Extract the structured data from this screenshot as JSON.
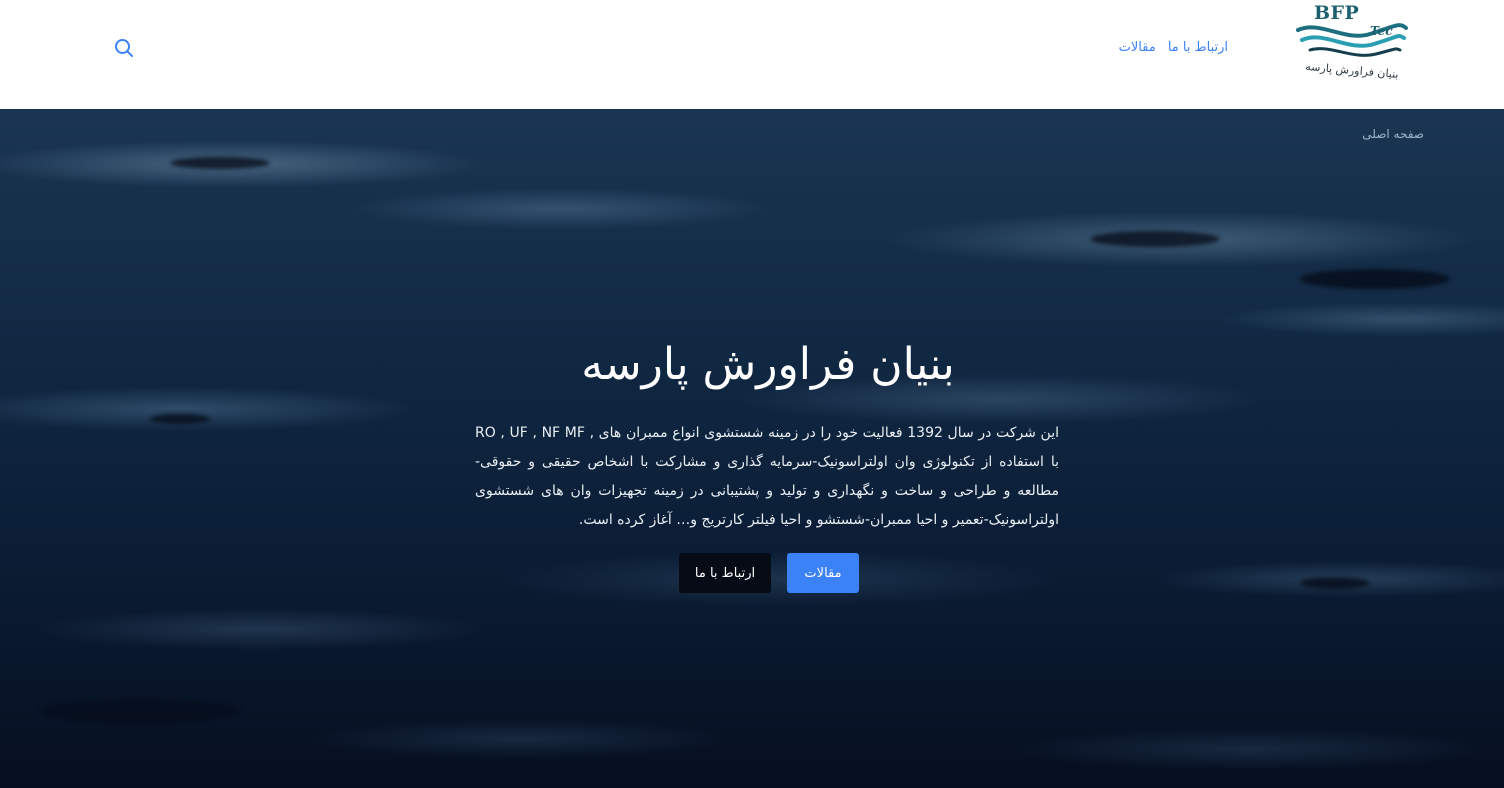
{
  "header": {
    "logo": {
      "brand": "BFP",
      "brand_suffix": "Tec",
      "tagline": "بنیان فراورش پارسه"
    },
    "nav": {
      "items": [
        {
          "label": "مقالات"
        },
        {
          "label": "ارتباط با ما"
        }
      ]
    },
    "search_icon": "search-icon"
  },
  "hero": {
    "breadcrumb": "صفحه اصلی",
    "title": "بنیان فراورش پارسه",
    "description": "این شرکت در سال 1392 فعالیت خود را در زمینه شستشوی انواع ممبران های , RO , UF , NF MF با استفاده از تکنولوژی وان اولتراسونیک-سرمایه گذاری و مشارکت با اشخاص حقیقی و حقوقی-مطالعه و طراحی و ساخت و نگهداری و تولید و پشتیبانی در زمینه تجهیزات وان های شستشوی اولتراسونیک-تعمیر و احیا ممبران-شستشو و احیا فیلتر کارتریج و… آغاز کرده است.",
    "buttons": {
      "primary": "مقالات",
      "secondary": "ارتباط با ما"
    }
  },
  "colors": {
    "accent": "#3b82f6",
    "logo_teal": "#1d5f6e",
    "hero_dark": "#060f20"
  }
}
